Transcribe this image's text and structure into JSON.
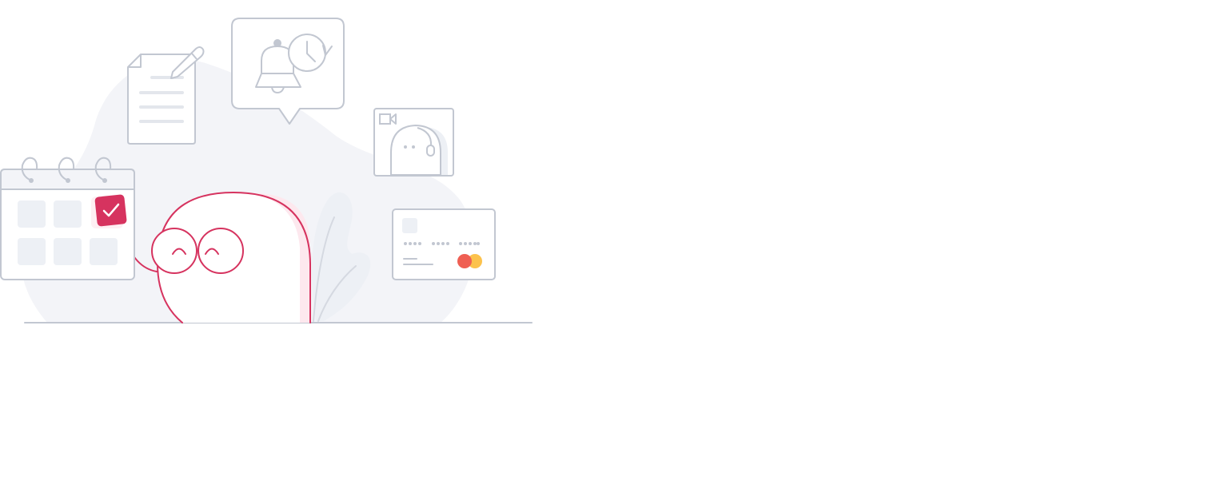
{
  "illustration": {
    "colors": {
      "line": "#c2c7d1",
      "fill_light": "#f3f4f8",
      "fill_tile": "#edf0f5",
      "accent": "#d6335f",
      "accent_light": "#fde8ee",
      "card_red": "#ef5f53",
      "card_yellow": "#fcc24c",
      "white": "#ffffff"
    },
    "icons": [
      "calendar-icon",
      "checkmark-icon",
      "document-icon",
      "pencil-icon",
      "notification-bell-icon",
      "clock-icon",
      "video-call-icon",
      "camera-icon",
      "credit-card-icon",
      "plant-leaf-icon"
    ]
  }
}
